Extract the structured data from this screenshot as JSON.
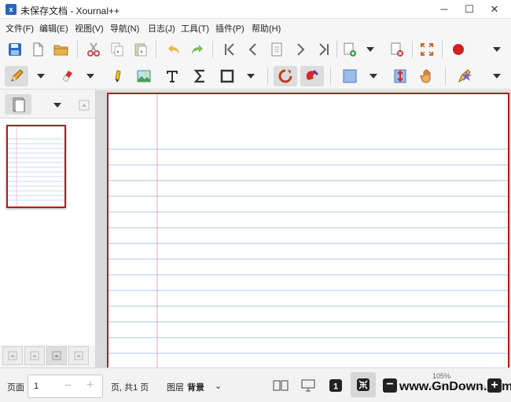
{
  "window": {
    "app_icon": "xournal-icon",
    "title": "未保存文档 - Xournal++",
    "minimize": "─",
    "maximize": "☐",
    "close": "✕"
  },
  "menu": [
    "文件(F)",
    "编辑(E)",
    "视图(V)",
    "导航(N)",
    "日志(J)",
    "工具(T)",
    "插件(P)",
    "帮助(H)"
  ],
  "toolbar1": [
    "save-icon",
    "new-document-icon",
    "open-folder-icon",
    "cut-icon",
    "copy-icon",
    "paste-icon",
    "undo-icon",
    "redo-icon",
    "goto-first-icon",
    "previous-page-icon",
    "goto-page-icon",
    "next-page-icon",
    "goto-last-icon",
    "new-page-icon",
    "delete-page-icon",
    "fullscreen-icon",
    "record-icon"
  ],
  "toolbar2": [
    "pen-icon",
    "eraser-icon",
    "highlighter-icon",
    "image-icon",
    "text-icon",
    "latex-icon",
    "shape-icon",
    "rotation-snap-icon",
    "grid-snap-icon",
    "select-rect-icon",
    "vertical-space-icon",
    "hand-icon",
    "default-tool-icon"
  ],
  "sidebar": {
    "page_view_icon": "pages-view-icon",
    "footer_buttons": [
      "move-up-icon",
      "move-down-icon",
      "copy-page-icon",
      "delete-page-icon"
    ]
  },
  "colors": {
    "accent_red": "#b01c1c",
    "line_blue": "#a8c4e8",
    "margin_pink": "#e8a0c8"
  },
  "status": {
    "page_label": "页面",
    "page_value": "1",
    "page_minus": "−",
    "page_plus": "+",
    "page_total": "页, 共1 页",
    "layer_label": "图层",
    "layer_value": "背景",
    "layer_dropdown": "⌄",
    "zoom": "105%",
    "zoom_out": "−",
    "zoom_in": "+",
    "watermark": "www.GnDown.com"
  }
}
